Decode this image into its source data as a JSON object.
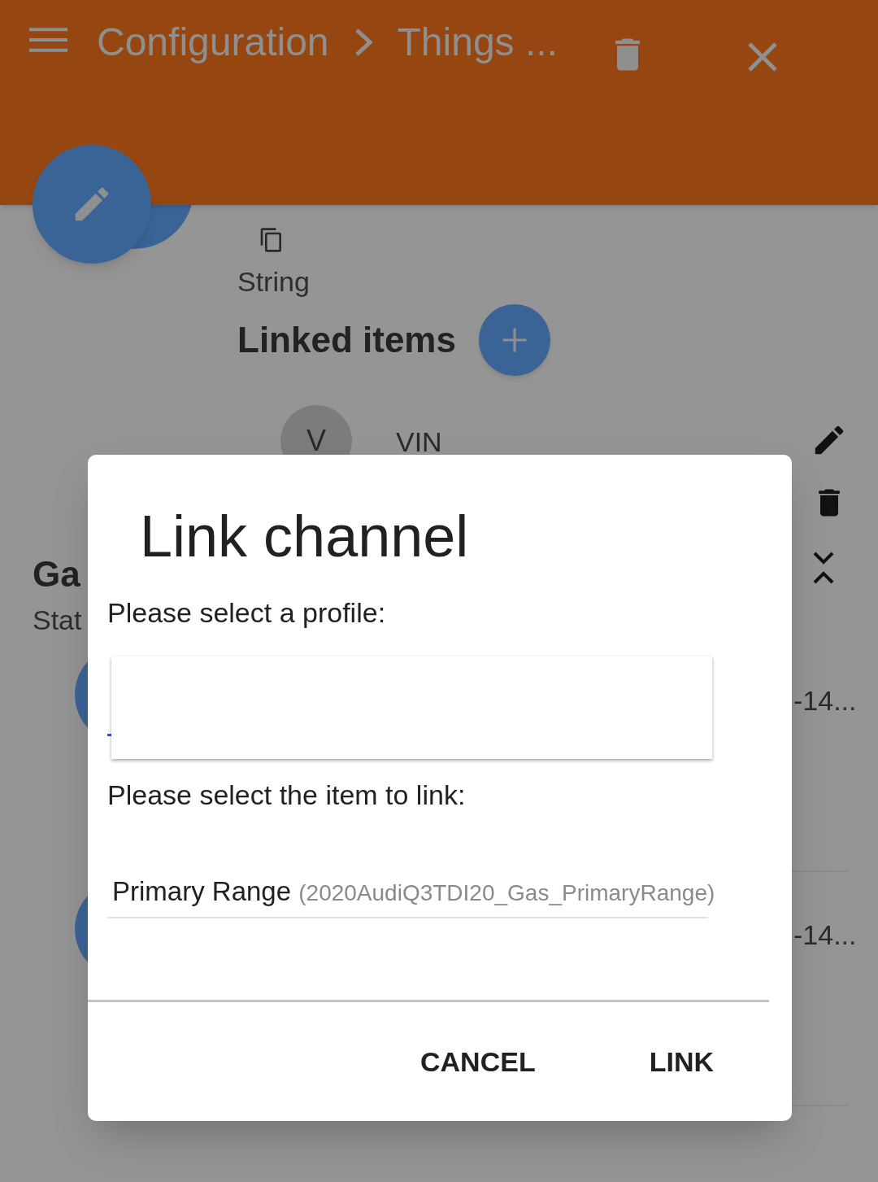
{
  "header": {
    "breadcrumb": [
      "Configuration",
      "Things ..."
    ]
  },
  "channel": {
    "type": "String",
    "linked_items_title": "Linked items",
    "items": [
      {
        "avatar": "V",
        "label": "VIN"
      }
    ]
  },
  "group": {
    "title": "Ga",
    "subtitle": "Stat",
    "readings": [
      "-14...",
      "-14..."
    ]
  },
  "dialog": {
    "title": "Link channel",
    "profile_label": "Please select a profile:",
    "item_label": "Please select the item to link:",
    "item_select": {
      "label": "Primary Range",
      "name": "(2020AudiQ3TDI20_Gas_PrimaryRange)"
    },
    "buttons": [
      "CANCEL",
      "LINK"
    ]
  }
}
